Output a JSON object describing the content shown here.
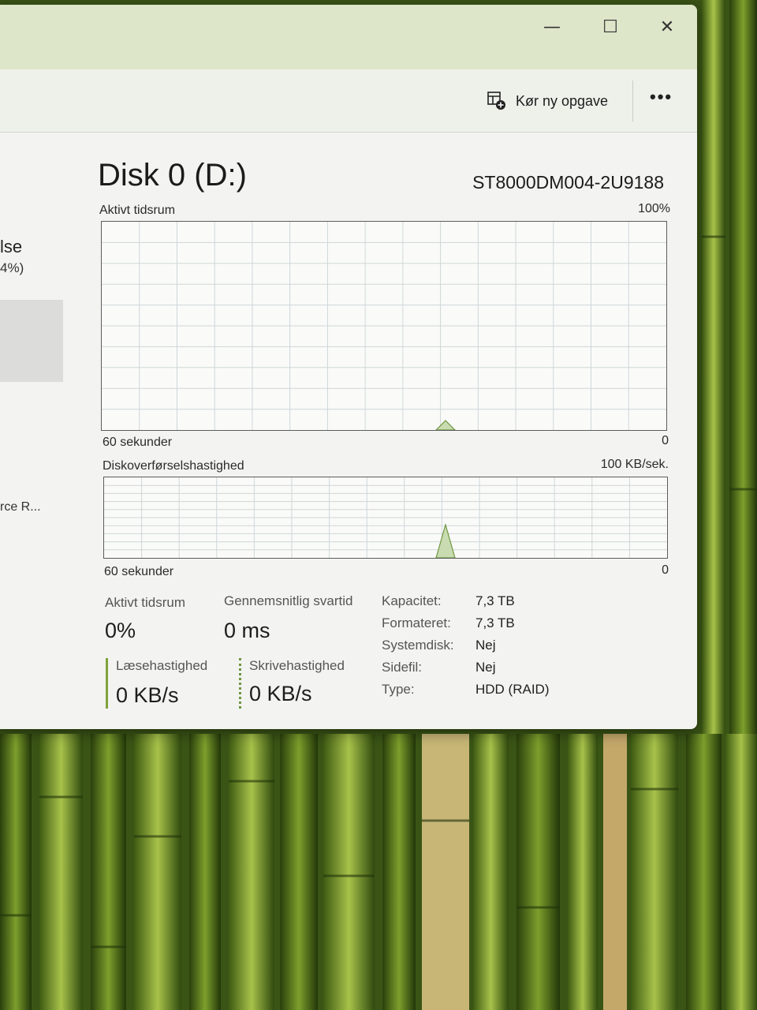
{
  "toolbar": {
    "new_task_label": "Kør ny opgave",
    "more_label": "•••"
  },
  "titlebar": {
    "minimize": "—",
    "maximize": "☐",
    "close": "✕"
  },
  "left_nav": {
    "title_fragment": "lse",
    "subtitle_fragment": "4%)",
    "item_fragment": "rce R..."
  },
  "disk": {
    "title": "Disk 0 (D:)",
    "model": "ST8000DM004-2U9188"
  },
  "active_time_graph": {
    "label": "Aktivt tidsrum",
    "max_label": "100%",
    "time_label": "60 sekunder",
    "min_label": "0"
  },
  "transfer_graph": {
    "label": "Diskoverførselshastighed",
    "max_label": "100 KB/sek.",
    "time_label": "60 sekunder",
    "min_label": "0"
  },
  "stats": {
    "active_time_label": "Aktivt tidsrum",
    "active_time_value": "0%",
    "response_label": "Gennemsnitlig svartid",
    "response_value": "0 ms",
    "read_label": "Læsehastighed",
    "read_value": "0 KB/s",
    "write_label": "Skrivehastighed",
    "write_value": "0 KB/s"
  },
  "properties": [
    {
      "label": "Kapacitet:",
      "value": "7,3 TB"
    },
    {
      "label": "Formateret:",
      "value": "7,3 TB"
    },
    {
      "label": "Systemdisk:",
      "value": "Nej"
    },
    {
      "label": "Sidefil:",
      "value": "Nej"
    },
    {
      "label": "Type:",
      "value": "HDD (RAID)"
    }
  ],
  "colors": {
    "accent": "#7ea33b",
    "graph_fill": "#c9dcb1",
    "graph_line": "#6e9640",
    "grid": "#cfd6d8"
  }
}
